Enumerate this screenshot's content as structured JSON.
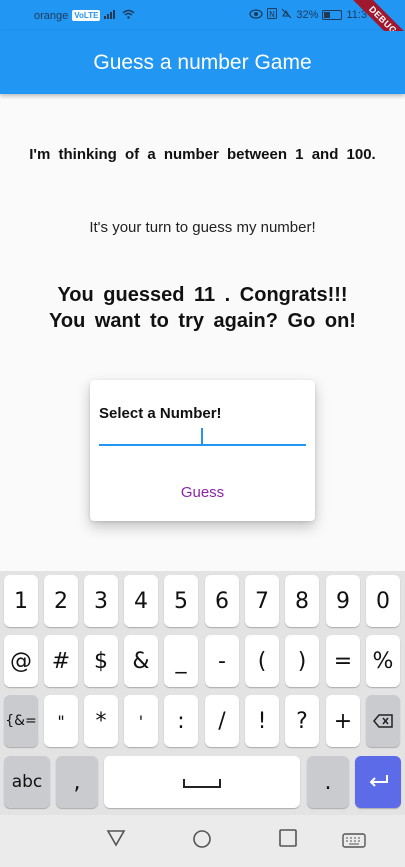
{
  "status": {
    "carrier": "orange",
    "network_badge": "VoLTE",
    "battery": "32%",
    "time": "11:3",
    "debug": "DEBUG"
  },
  "appbar": {
    "title": "Guess a number Game"
  },
  "main": {
    "line1": "I'm thinking of a number between 1 and 100.",
    "line2": "It's your turn to guess my number!",
    "line3a": "You guessed 11 . Congrats!!!",
    "line3b": "You want to try again? Go on!"
  },
  "dialog": {
    "label": "Select a Number!",
    "input_value": "",
    "button": "Guess"
  },
  "keyboard": {
    "row1": [
      "1",
      "2",
      "3",
      "4",
      "5",
      "6",
      "7",
      "8",
      "9",
      "0"
    ],
    "row2": [
      "@",
      "#",
      "$",
      "&",
      "_",
      "-",
      "(",
      ")",
      "=",
      "%"
    ],
    "row3": [
      "{&=",
      "\"",
      "*",
      "'",
      ":",
      "/",
      "!",
      "?",
      "+"
    ],
    "row4": {
      "abc": "abc",
      "comma": ",",
      "period": "."
    }
  },
  "colors": {
    "primary": "#2196f3",
    "accent": "#8e24aa",
    "enter": "#5c6be8"
  }
}
